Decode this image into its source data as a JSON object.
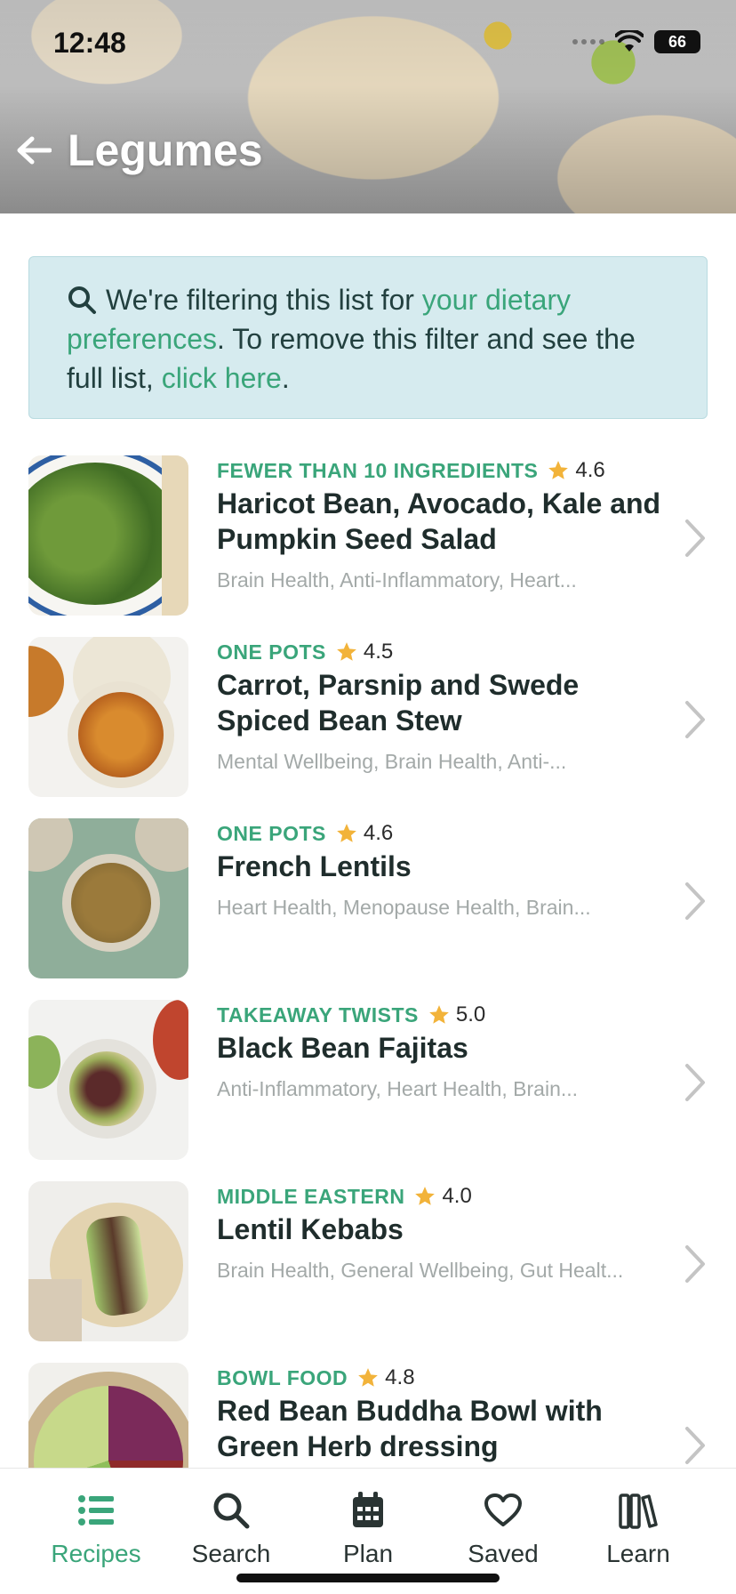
{
  "status": {
    "time": "12:48",
    "battery": "66"
  },
  "header": {
    "title": "Legumes"
  },
  "filter_banner": {
    "text_1": "We're filtering this list for ",
    "link_1": "your dietary preferences",
    "text_2": ". To remove this filter and see the full list, ",
    "link_2": "click here",
    "text_3": "."
  },
  "recipes": [
    {
      "category": "FEWER THAN 10 INGREDIENTS",
      "rating": "4.6",
      "title": "Haricot Bean, Avocado, Kale and Pumpkin Seed Salad",
      "tags": "Brain Health, Anti-Inflammatory, Heart..."
    },
    {
      "category": "ONE POTS",
      "rating": "4.5",
      "title": "Carrot, Parsnip and Swede Spiced Bean Stew",
      "tags": "Mental Wellbeing, Brain Health, Anti-..."
    },
    {
      "category": "ONE POTS",
      "rating": "4.6",
      "title": "French Lentils",
      "tags": "Heart Health, Menopause Health, Brain..."
    },
    {
      "category": "TAKEAWAY TWISTS",
      "rating": "5.0",
      "title": "Black Bean Fajitas",
      "tags": "Anti-Inflammatory, Heart Health, Brain..."
    },
    {
      "category": "MIDDLE EASTERN",
      "rating": "4.0",
      "title": "Lentil Kebabs",
      "tags": "Brain Health, General Wellbeing, Gut Healt..."
    },
    {
      "category": "BOWL FOOD",
      "rating": "4.8",
      "title": "Red Bean Buddha Bowl with Green Herb dressing",
      "tags": ""
    }
  ],
  "tabs": [
    {
      "label": "Recipes",
      "icon": "list-icon",
      "active": true
    },
    {
      "label": "Search",
      "icon": "search-icon",
      "active": false
    },
    {
      "label": "Plan",
      "icon": "calendar-icon",
      "active": false
    },
    {
      "label": "Saved",
      "icon": "heart-icon",
      "active": false
    },
    {
      "label": "Learn",
      "icon": "books-icon",
      "active": false
    }
  ],
  "colors": {
    "accent": "#3aa57a",
    "banner_bg": "#d6ebef",
    "star": "#f2b33a",
    "text": "#1f2d2c",
    "muted": "#a3a9a8"
  }
}
